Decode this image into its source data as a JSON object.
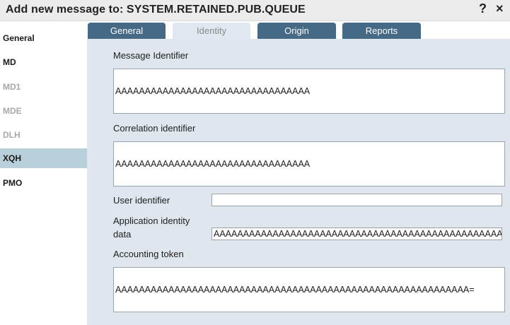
{
  "window": {
    "title": "Add new message to: SYSTEM.RETAINED.PUB.QUEUE",
    "help_glyph": "?",
    "close_glyph": "×"
  },
  "sidebar": {
    "items": [
      {
        "label": "General",
        "state": "enabled"
      },
      {
        "label": "MD",
        "state": "enabled"
      },
      {
        "label": "MD1",
        "state": "disabled"
      },
      {
        "label": "MDE",
        "state": "disabled"
      },
      {
        "label": "DLH",
        "state": "disabled"
      },
      {
        "label": "XQH",
        "state": "selected"
      },
      {
        "label": "PMO",
        "state": "enabled"
      }
    ]
  },
  "tabs": [
    {
      "label": "General",
      "active": false
    },
    {
      "label": "Identity",
      "active": true
    },
    {
      "label": "Origin",
      "active": false
    },
    {
      "label": "Reports",
      "active": false
    }
  ],
  "form": {
    "message_identifier": {
      "label": "Message Identifier",
      "value": "AAAAAAAAAAAAAAAAAAAAAAAAAAAAAAAAA"
    },
    "correlation_identifier": {
      "label": "Correlation identifier",
      "value": "AAAAAAAAAAAAAAAAAAAAAAAAAAAAAAAAA"
    },
    "user_identifier": {
      "label": "User identifier",
      "value": ""
    },
    "application_identity_data": {
      "label_line1": "Application identity",
      "label_line2": "data",
      "value": "AAAAAAAAAAAAAAAAAAAAAAAAAAAAAAAAAAAAAAAAAAAAAAAAAAAAAAA="
    },
    "accounting_token": {
      "label": "Accounting token",
      "value": "AAAAAAAAAAAAAAAAAAAAAAAAAAAAAAAAAAAAAAAAAAAAAAAAAAAAAAAAAAAA="
    }
  },
  "colors": {
    "tab_inactive": "#466a85",
    "tab_active": "#e1e7ee",
    "content_background": "#dfe6ee",
    "sidebar_selected": "#b9cfd9"
  }
}
